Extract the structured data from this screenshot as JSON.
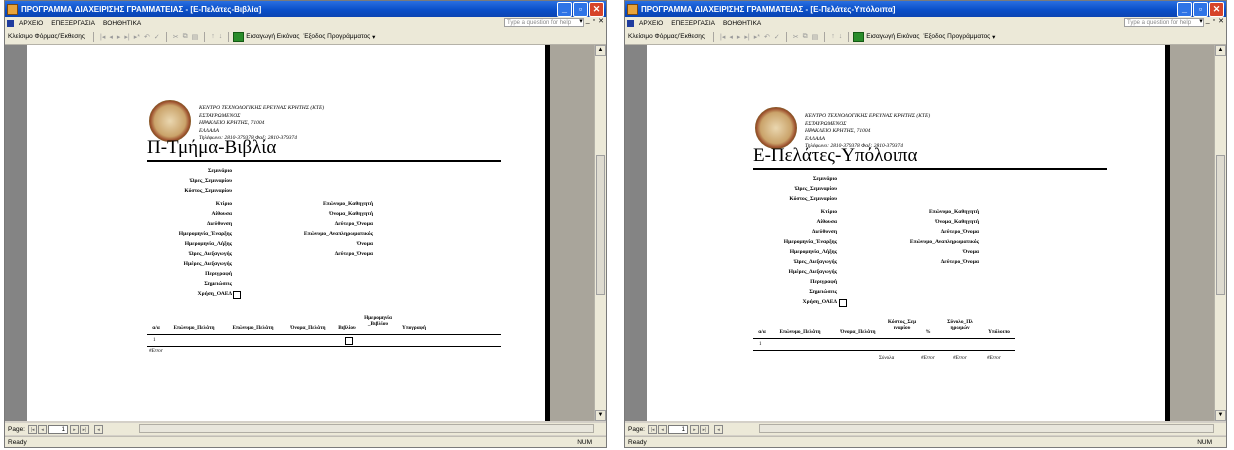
{
  "windows": [
    {
      "title": "ΠΡΟΓΡΑΜΜΑ ΔΙΑΧΕΙΡΙΣΗΣ ΓΡΑΜΜΑΤΕΙΑΣ - [Ε-Πελάτες-Βιβλία]",
      "menu": [
        "ΑΡΧΕΙΟ",
        "ΕΠΕΞΕΡΓΑΣΙΑ",
        "ΒΟΗΘΗΤΙΚΑ"
      ],
      "help_placeholder": "Type a question for help",
      "toolbar": {
        "close_preview": "Κλείσιμο Φόρμας/Έκθεσης",
        "insert_picture": "Εισαγωγή Εικόνας",
        "exit": "Έξοδος Προγράμματος"
      },
      "org_lines": [
        "ΚΕΝΤΡΟ ΤΕΧΝΟΛΟΓΙΚΗΣ ΕΡΕΥΝΑΣ ΚΡΗΤΗΣ (ΚΤΕ)",
        "ΕΣΤΑΥΡΩΜΕΝΟΣ",
        "ΗΡΑΚΛΕΙΟ ΚΡΗΤΗΣ, 71004",
        "ΕΛΛΑΔΑ",
        "Τηλέφωνο: 2810-379378  Φαξ: 2810-379374"
      ],
      "report_title": "Π-Τμήμα-Βιβλία",
      "left_fields": [
        "Σεμινάριο",
        "Ώρες_Σεμιναρίου",
        "Κόστος_Σεμιναρίου",
        "Κτίριο",
        "Αίθουσα",
        "Διεύθυνση",
        "Ημερομηνία_Έναρξης",
        "Ημερομηνία_Λήξης",
        "Ώρες_Διεξαγωγής",
        "Ημέρες_Διεξαγωγής",
        "Περιγραφή",
        "Σημειώσεις",
        "Χρήση_ΟΑΕΔ"
      ],
      "right_fields": [
        "Επώνυμο_Καθηγητή",
        "Όνομα_Καθηγητή",
        "Δεύτερο_Όνομα",
        "Επώνυμο_Αναπληρωματικός",
        "Όνομα",
        "Δεύτερο_Όνομα"
      ],
      "columns": [
        "α/α",
        "Επώνυμο_Πελάτη",
        "Επώνυμο_Πελάτη",
        "Όνομα_Πελάτη",
        "Βιβλίου",
        "Ημερομηνία _Βιβλίου",
        "Υπογραφή"
      ],
      "row_number": "1",
      "error_text": "#Error",
      "page_label": "Page:",
      "page_number": "1",
      "status_left": "Ready",
      "status_right": "NUM"
    },
    {
      "title": "ΠΡΟΓΡΑΜΜΑ ΔΙΑΧΕΙΡΙΣΗΣ ΓΡΑΜΜΑΤΕΙΑΣ - [Ε-Πελάτες-Υπόλοιπα]",
      "menu": [
        "ΑΡΧΕΙΟ",
        "ΕΠΕΞΕΡΓΑΣΙΑ",
        "ΒΟΗΘΗΤΙΚΑ"
      ],
      "help_placeholder": "Type a question for help",
      "toolbar": {
        "close_preview": "Κλείσιμο Φόρμας/Έκθεσης",
        "insert_picture": "Εισαγωγή Εικόνας",
        "exit": "Έξοδος Προγράμματος"
      },
      "org_lines": [
        "ΚΕΝΤΡΟ ΤΕΧΝΟΛΟΓΙΚΗΣ ΕΡΕΥΝΑΣ ΚΡΗΤΗΣ (ΚΤΕ)",
        "ΕΣΤΑΥΡΩΜΕΝΟΣ",
        "ΗΡΑΚΛΕΙΟ ΚΡΗΤΗΣ, 71004",
        "ΕΛΛΑΔΑ",
        "Τηλέφωνο: 2810-379378  Φαξ: 2810-379374"
      ],
      "report_title": "Ε-Πελάτες-Υπόλοιπα",
      "left_fields": [
        "Σεμινάριο",
        "Ώρες_Σεμιναρίου",
        "Κόστος_Σεμιναρίου",
        "Κτίριο",
        "Αίθουσα",
        "Διεύθυνση",
        "Ημερομηνία_Έναρξης",
        "Ημερομηνία_Λήξης",
        "Ώρες_Διεξαγωγής",
        "Ημέρες_Διεξαγωγής",
        "Περιγραφή",
        "Σημειώσεις",
        "Χρήση_ΟΑΕΔ"
      ],
      "right_fields": [
        "Επώνυμο_Καθηγητή",
        "Όνομα_Καθηγητή",
        "Δεύτερο_Όνομα",
        "Επώνυμο_Αναπληρωματικός",
        "Όνομα",
        "Δεύτερο_Όνομα"
      ],
      "columns": [
        "α/α",
        "Επώνυμο_Πελάτη",
        "Όνομα_Πελάτη",
        "Κόστος_Σεμ ιναρίου",
        "%",
        "Σύνολο_Πλ ηρωμών",
        "Υπόλοιπο"
      ],
      "row_number": "1",
      "totals_label": "Σύνολα",
      "error_text": "#Error",
      "page_label": "Page:",
      "page_number": "1",
      "status_left": "Ready",
      "status_right": "NUM"
    }
  ]
}
